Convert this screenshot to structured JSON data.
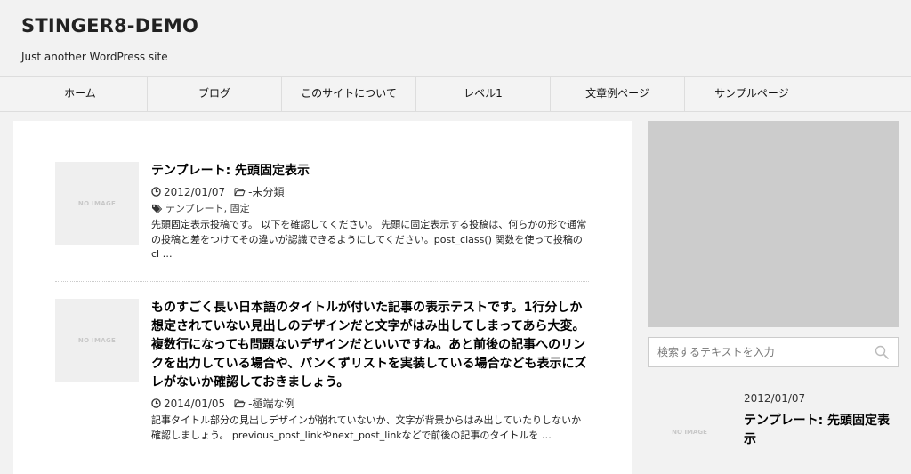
{
  "header": {
    "site_title": "STINGER8-DEMO",
    "site_description": "Just another WordPress site"
  },
  "nav": {
    "items": [
      {
        "label": "ホーム"
      },
      {
        "label": "ブログ"
      },
      {
        "label": "このサイトについて"
      },
      {
        "label": "レベル1"
      },
      {
        "label": "文章例ページ"
      },
      {
        "label": "サンプルページ"
      }
    ]
  },
  "posts": [
    {
      "thumb_text": "NO IMAGE",
      "title": "テンプレート: 先頭固定表示",
      "date": "2012/01/07",
      "category": "-未分類",
      "tags": "テンプレート, 固定",
      "excerpt": "先頭固定表示投稿です。 以下を確認してください。 先頭に固定表示する投稿は、何らかの形で通常の投稿と差をつけてその違いが認識できるようにしてください。post_class() 関数を使って投稿の cl …"
    },
    {
      "thumb_text": "NO IMAGE",
      "title": "ものすごく長い日本語のタイトルが付いた記事の表示テストです。1行分しか想定されていない見出しのデザインだと文字がはみ出してしまってあら大変。複数行になっても問題ないデザインだといいですね。あと前後の記事へのリンクを出力している場合や、パンくずリストを実装している場合なども表示にズレがないか確認しておきましょう。",
      "date": "2014/01/05",
      "category": "-極端な例",
      "excerpt": "記事タイトル部分の見出しデザインが崩れていないか、文字が背景からはみ出していたりしないか確認しましょう。 previous_post_linkやnext_post_linkなどで前後の記事のタイトルを …"
    }
  ],
  "sidebar": {
    "search": {
      "placeholder": "検索するテキストを入力"
    },
    "recent_post": {
      "thumb_text": "NO IMAGE",
      "date": "2012/01/07",
      "title": "テンプレート: 先頭固定表示"
    }
  },
  "icons": {
    "clock": "clock-icon",
    "folder": "folder-open-icon",
    "tag": "tags-icon",
    "search": "search-icon"
  }
}
